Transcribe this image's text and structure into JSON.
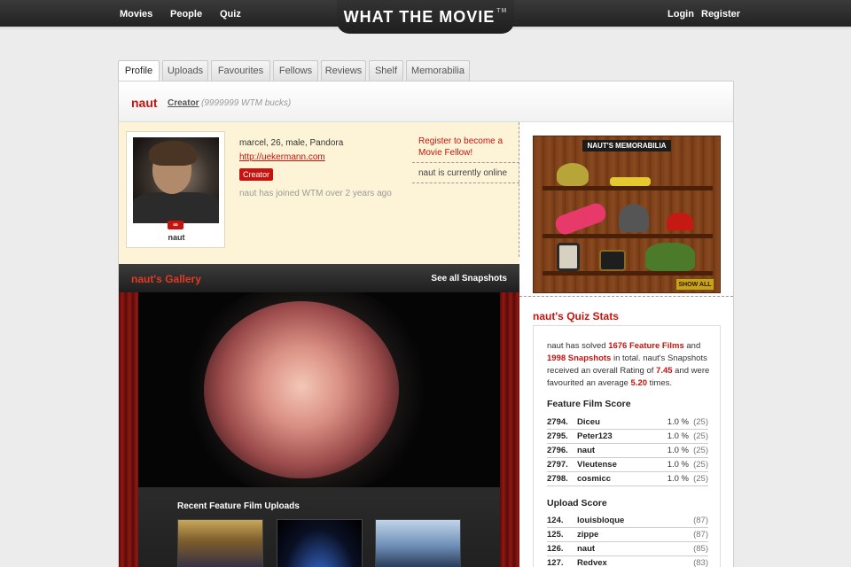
{
  "topnav": {
    "left": [
      "Movies",
      "People",
      "Quiz"
    ],
    "logo": "WHAT THE MOVIE",
    "logo_tm": "TM",
    "right": [
      "Login",
      "Register"
    ]
  },
  "tabs": [
    "Profile",
    "Uploads",
    "Favourites",
    "Fellows",
    "Reviews",
    "Shelf",
    "Memorabilia"
  ],
  "profile": {
    "username": "naut",
    "role": "Creator",
    "bucks": "(9999999 WTM bucks)",
    "info": "marcel, 26, male, Pandora",
    "url": "http://uekermann.com",
    "badge": "Creator",
    "joined": "naut has joined WTM over 2 years ago",
    "avatar_name": "naut",
    "infinity": "∞"
  },
  "side_links": {
    "register": "Register to become a Movie Fellow!",
    "online": "naut is currently online"
  },
  "gallery": {
    "title": "naut's Gallery",
    "see_all": "See all Snapshots",
    "recent_title": "Recent Feature Film Uploads"
  },
  "memorabilia": {
    "title": "NAUT'S MEMORABILIA",
    "show_all": "SHOW ALL"
  },
  "quiz": {
    "title": "naut's Quiz Stats",
    "summary_parts": [
      "naut has solved ",
      "1676 Feature Films",
      " and ",
      "1998 Snapshots",
      " in total. naut's Snapshots received an overall Rating of ",
      "7.45",
      " and were favourited an average ",
      "5.20",
      " times."
    ],
    "feature_title": "Feature Film Score",
    "feature_rows": [
      {
        "rank": "2794.",
        "name": "Diceu",
        "pct": "1.0 %",
        "count": "(25)"
      },
      {
        "rank": "2795.",
        "name": "Peter123",
        "pct": "1.0 %",
        "count": "(25)"
      },
      {
        "rank": "2796.",
        "name": "naut",
        "pct": "1.0 %",
        "count": "(25)"
      },
      {
        "rank": "2797.",
        "name": "Vleutense",
        "pct": "1.0 %",
        "count": "(25)"
      },
      {
        "rank": "2798.",
        "name": "cosmicc",
        "pct": "1.0 %",
        "count": "(25)"
      }
    ],
    "upload_title": "Upload Score",
    "upload_rows": [
      {
        "rank": "124.",
        "name": "louisbloque",
        "count": "(87)"
      },
      {
        "rank": "125.",
        "name": "zippe",
        "count": "(87)"
      },
      {
        "rank": "126.",
        "name": "naut",
        "count": "(85)"
      },
      {
        "rank": "127.",
        "name": "Redvex",
        "count": "(83)"
      }
    ]
  }
}
